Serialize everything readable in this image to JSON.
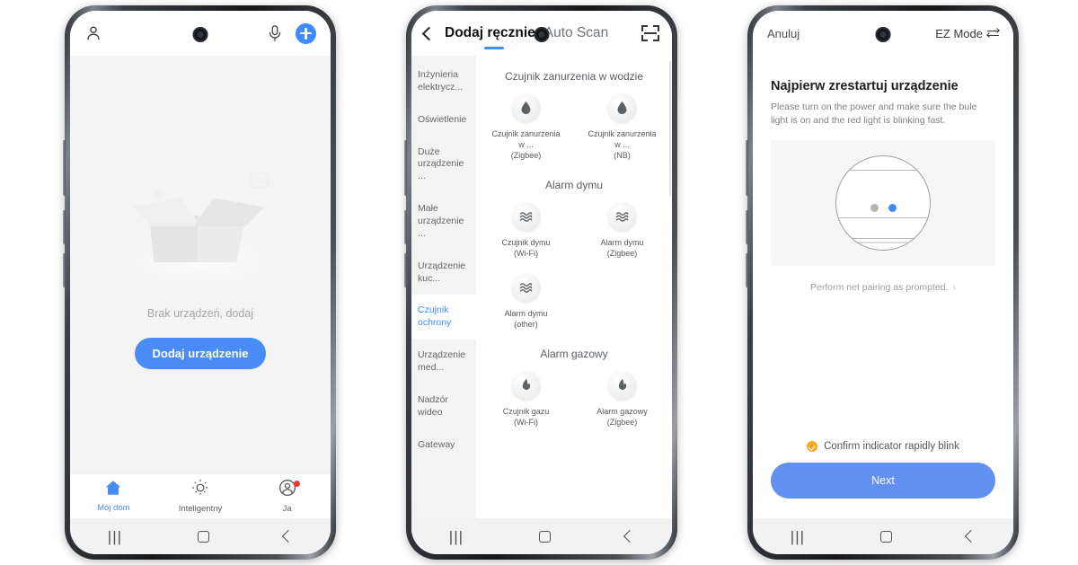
{
  "phone1": {
    "header": {
      "profile_icon": "person-icon",
      "mic_icon": "microphone-icon",
      "add_icon": "plus-icon"
    },
    "empty_state": {
      "illustration": "empty-box-illustration",
      "message": "Brak urządzeń, dodaj",
      "add_button": "Dodaj urządzenie"
    },
    "tabbar": [
      {
        "label": "Mój dom",
        "icon": "home-icon",
        "active": true,
        "badge": false
      },
      {
        "label": "Inteligentny",
        "icon": "sun-icon",
        "active": false,
        "badge": false
      },
      {
        "label": "Ja",
        "icon": "profile-circle-icon",
        "active": false,
        "badge": true
      }
    ]
  },
  "phone2": {
    "header": {
      "back_icon": "chevron-left-icon",
      "tab_manual": "Dodaj ręcznie",
      "tab_auto": "Auto Scan",
      "scan_icon": "scan-frame-icon"
    },
    "categories": [
      {
        "label": "Inżynieria elektrycz...",
        "active": false
      },
      {
        "label": "Oświetlenie",
        "active": false
      },
      {
        "label": "Duże urządzenie ...",
        "active": false
      },
      {
        "label": "Małe urządzenie ...",
        "active": false
      },
      {
        "label": "Urządzenie kuc...",
        "active": false
      },
      {
        "label": "Czujnik ochrony",
        "active": true
      },
      {
        "label": "Urządzenie med...",
        "active": false
      },
      {
        "label": "Nadzór wideo",
        "active": false
      },
      {
        "label": "Gateway",
        "active": false
      }
    ],
    "groups": [
      {
        "title": "Czujnik zanurzenia w wodzie",
        "devices": [
          {
            "name": "Czujnik zanurzenia w ...",
            "protocol": "(Zigbee)",
            "icon": "water-drop-icon"
          },
          {
            "name": "Czujnik zanurzenia w ...",
            "protocol": "(NB)",
            "icon": "water-drop-icon"
          }
        ]
      },
      {
        "title": "Alarm dymu",
        "devices": [
          {
            "name": "Czujnik dymu",
            "protocol": "(Wi-Fi)",
            "icon": "smoke-waves-icon"
          },
          {
            "name": "Alarm dymu",
            "protocol": "(Zigbee)",
            "icon": "smoke-waves-icon"
          },
          {
            "name": "Alarm dymu",
            "protocol": "(other)",
            "icon": "smoke-waves-icon"
          }
        ]
      },
      {
        "title": "Alarm gazowy",
        "devices": [
          {
            "name": "Czujnik gazu",
            "protocol": "(Wi-Fi)",
            "icon": "flame-icon"
          },
          {
            "name": "Alarm gazowy",
            "protocol": "(Zigbee)",
            "icon": "flame-icon"
          }
        ]
      }
    ]
  },
  "phone3": {
    "header": {
      "cancel": "Anuluj",
      "mode": "EZ Mode",
      "mode_icon": "swap-arrows-icon"
    },
    "title": "Najpierw zrestartuj urządzenie",
    "subtitle": "Please turn on the power and make sure the bule light is on and the red light is blinking fast.",
    "illustration": "smart-bulb-illustration",
    "perform_link": "Perform net pairing as prompted.",
    "perform_arrow": "›",
    "confirm_label": "Confirm indicator rapidly blink",
    "next_button": "Next"
  },
  "navbar": {
    "recents_icon": "recents-icon",
    "home_icon": "home-square-icon",
    "back_icon": "back-chevron-icon",
    "recents_glyph": "|||"
  },
  "colors": {
    "accent_blue": "#3d8bfd",
    "button_blue": "#4a8cf7",
    "next_blue": "#6090f0",
    "badge_red": "#f0372c",
    "check_orange": "#f5a623"
  }
}
